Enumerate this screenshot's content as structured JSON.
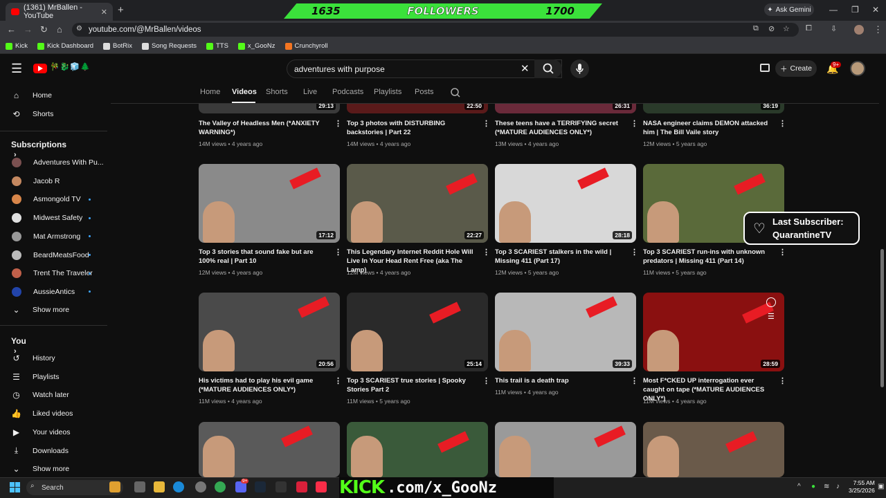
{
  "browser": {
    "tab_title": "(1361) MrBallen - YouTube",
    "new_tab": "+",
    "url": "youtube.com/@MrBallen/videos",
    "gemini_label": "Ask Gemini",
    "bookmarks": [
      {
        "label": "Kick",
        "color": "#53fc18"
      },
      {
        "label": "Kick Dashboard",
        "color": "#53fc18"
      },
      {
        "label": "BotRix",
        "color": "#dddddd"
      },
      {
        "label": "Song Requests",
        "color": "#dddddd"
      },
      {
        "label": "TTS",
        "color": "#53fc18"
      },
      {
        "label": "x_GooNz",
        "color": "#53fc18"
      },
      {
        "label": "Crunchyroll",
        "color": "#f47521"
      }
    ]
  },
  "stream_overlay": {
    "followers_current": "1635",
    "followers_label": "FOLLOWERS",
    "followers_goal": "1700",
    "last_subscriber_label": "Last Subscriber:",
    "last_subscriber_name": "QuarantineTV",
    "kick_word": "KICK",
    "kick_rest": ".com/x_GooNz"
  },
  "youtube": {
    "logo_text": "🎋🐉🧊🌲",
    "search_value": "adventures with purpose",
    "create_label": "Create",
    "notifications_badge": "9+",
    "sidebar": {
      "top_items": [
        {
          "label": "Home",
          "icon": "home-icon",
          "glyph": "⌂"
        },
        {
          "label": "Shorts",
          "icon": "shorts-icon",
          "glyph": "⟲"
        }
      ],
      "subscriptions_title": "Subscriptions",
      "subscriptions": [
        {
          "label": "Adventures With Pu...",
          "color": "#7a5050",
          "dot": false
        },
        {
          "label": "Jacob R",
          "color": "#c48860",
          "dot": false
        },
        {
          "label": "Asmongold TV",
          "color": "#d8864a",
          "dot": true
        },
        {
          "label": "Midwest Safety",
          "color": "#e0e0e0",
          "dot": true
        },
        {
          "label": "Mat Armstrong",
          "color": "#999999",
          "dot": true
        },
        {
          "label": "BeardMeatsFood",
          "color": "#bbbbbb",
          "dot": true
        },
        {
          "label": "Trent The Traveler",
          "color": "#c0604a",
          "dot": true
        },
        {
          "label": "AussieAntics",
          "color": "#2244aa",
          "dot": true
        }
      ],
      "show_more": "Show more",
      "you_title": "You",
      "you_items": [
        {
          "label": "History",
          "icon": "history-icon",
          "glyph": "↺"
        },
        {
          "label": "Playlists",
          "icon": "playlists-icon",
          "glyph": "☰"
        },
        {
          "label": "Watch later",
          "icon": "watch-later-icon",
          "glyph": "◷"
        },
        {
          "label": "Liked videos",
          "icon": "liked-icon",
          "glyph": "👍"
        },
        {
          "label": "Your videos",
          "icon": "your-videos-icon",
          "glyph": "▶"
        },
        {
          "label": "Downloads",
          "icon": "downloads-icon",
          "glyph": "⤓"
        }
      ],
      "show_more_2": "Show more"
    },
    "channel_tabs": [
      "Home",
      "Videos",
      "Shorts",
      "Live",
      "Podcasts",
      "Playlists",
      "Posts"
    ],
    "active_tab": "Videos",
    "videos": [
      {
        "title": "The Valley of Headless Men (*ANXIETY WARNING*)",
        "views": "14M views",
        "age": "4 years ago",
        "duration": "29:13",
        "bg": "#3a3a3a"
      },
      {
        "title": "Top 3 photos with DISTURBING backstories | Part 22",
        "views": "14M views",
        "age": "4 years ago",
        "duration": "22:50",
        "bg": "#5a1a1a"
      },
      {
        "title": "These teens have a TERRIFYING secret (*MATURE AUDIENCES ONLY*)",
        "views": "13M views",
        "age": "4 years ago",
        "duration": "26:31",
        "bg": "#6a2a3a"
      },
      {
        "title": "NASA engineer claims DEMON attacked him | The Bill Vaile story",
        "views": "12M views",
        "age": "5 years ago",
        "duration": "36:19",
        "bg": "#2a3a2a"
      },
      {
        "title": "Top 3 stories that sound fake but are 100% real | Part 10",
        "views": "12M views",
        "age": "4 years ago",
        "duration": "17:12",
        "bg": "#8a8a8a"
      },
      {
        "title": "This Legendary Internet Reddit Hole Will Live In Your Head Rent Free (aka The Lamp)",
        "views": "12M views",
        "age": "4 years ago",
        "duration": "22:27",
        "bg": "#5a5a4a"
      },
      {
        "title": "Top 3 SCARIEST stalkers in the wild | Missing 411 (Part 17)",
        "views": "12M views",
        "age": "5 years ago",
        "duration": "28:18",
        "bg": "#d8d8d8"
      },
      {
        "title": "Top 3 SCARIEST run-ins with unknown predators | Missing 411 (Part 14)",
        "views": "11M views",
        "age": "5 years ago",
        "duration": "",
        "bg": "#5a6a3a"
      },
      {
        "title": "His victims had to play his evil game (*MATURE AUDIENCES ONLY*)",
        "views": "11M views",
        "age": "4 years ago",
        "duration": "20:56",
        "bg": "#4a4a4a"
      },
      {
        "title": "Top 3 SCARIEST true stories | Spooky Stories Part 2",
        "views": "11M views",
        "age": "5 years ago",
        "duration": "25:14",
        "bg": "#2a2a2a"
      },
      {
        "title": "This trail is a death trap",
        "views": "11M views",
        "age": "4 years ago",
        "duration": "39:33",
        "bg": "#b8b8b8"
      },
      {
        "title": "Most F*CKED UP interrogation ever caught on tape (*MATURE AUDIENCES ONLY*)",
        "views": "11M views",
        "age": "4 years ago",
        "duration": "28:59",
        "bg": "#8a1010"
      },
      {
        "title": "",
        "views": "",
        "age": "",
        "duration": "",
        "bg": "#5a5a5a"
      },
      {
        "title": "",
        "views": "",
        "age": "",
        "duration": "",
        "bg": "#3a5a3a"
      },
      {
        "title": "",
        "views": "",
        "age": "",
        "duration": "",
        "bg": "#9a9a9a"
      },
      {
        "title": "",
        "views": "",
        "age": "",
        "duration": "",
        "bg": "#6a5a4a"
      }
    ]
  },
  "taskbar": {
    "search_placeholder": "Search",
    "time": "7:55 AM",
    "date": "3/25/2026",
    "discord_badge": "9+"
  }
}
